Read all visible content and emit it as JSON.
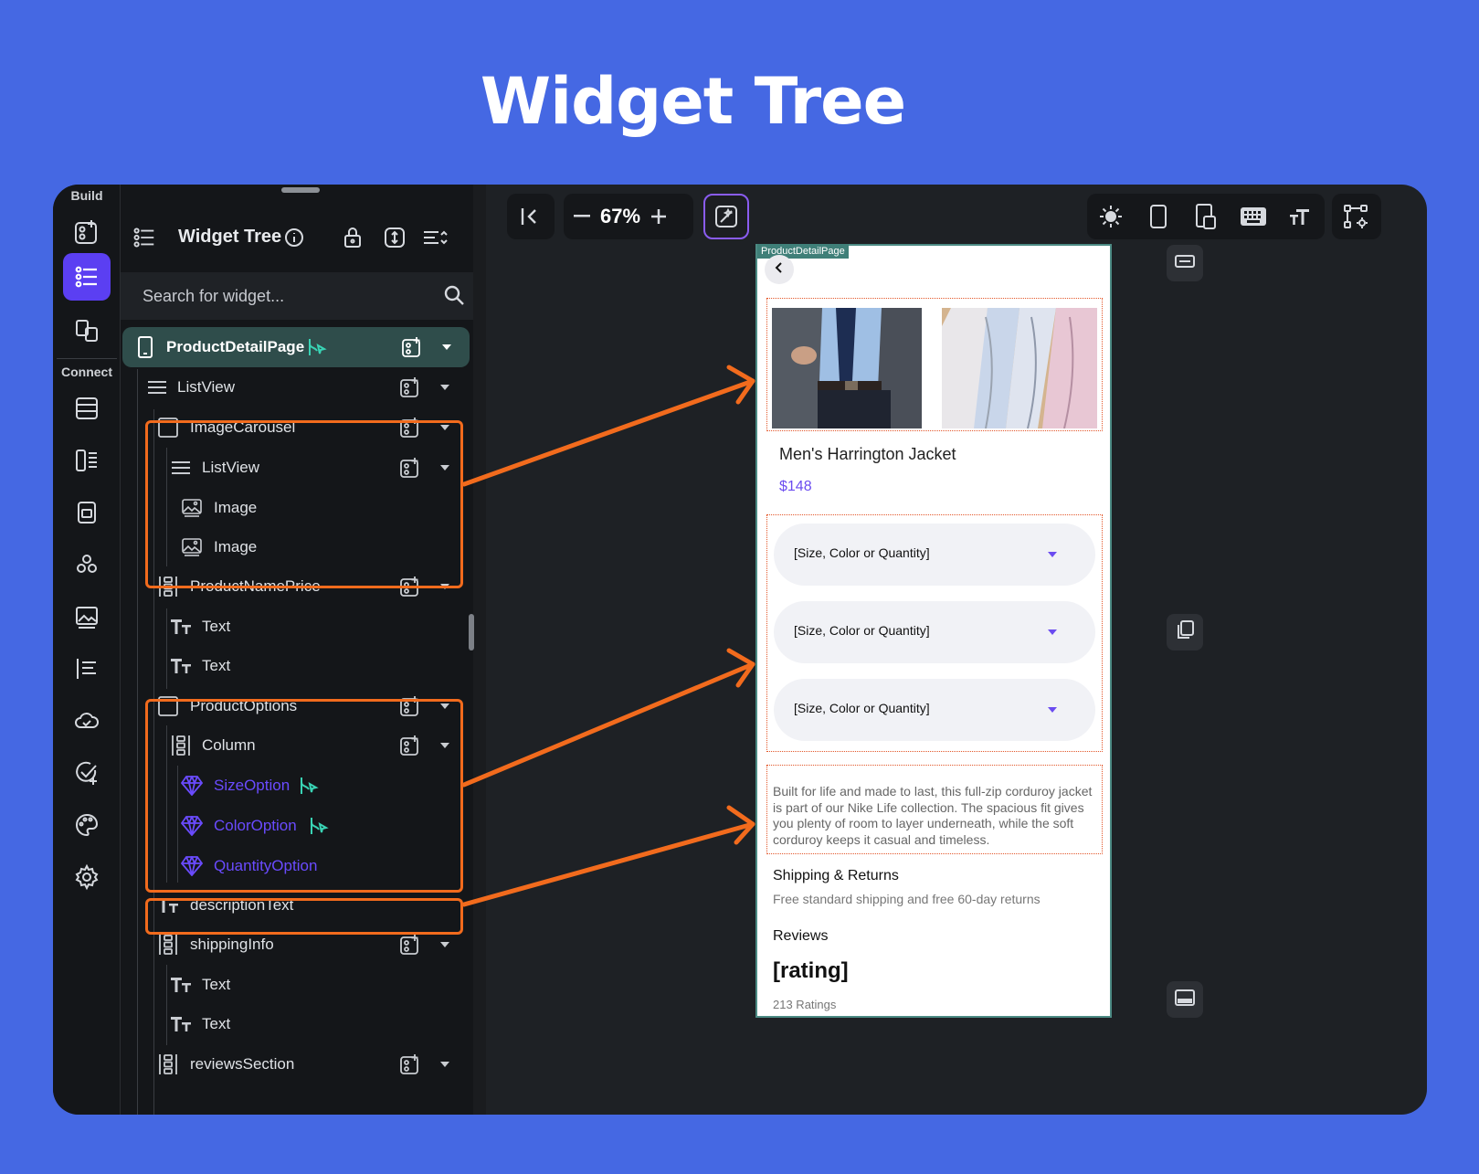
{
  "hero_title": "Widget Tree",
  "rail": {
    "build_label": "Build",
    "connect_label": "Connect"
  },
  "tree_panel": {
    "title": "Widget Tree",
    "search_placeholder": "Search for widget...",
    "rows": {
      "root": "ProductDetailPage",
      "listview_outer": "ListView",
      "image_carousel": "ImageCarousel",
      "listview_inner": "ListView",
      "image_1": "Image",
      "image_2": "Image",
      "product_name_price": "ProductNamePrice",
      "text_1": "Text",
      "text_2": "Text",
      "product_options": "ProductOptions",
      "column": "Column",
      "size_option": "SizeOption",
      "color_option": "ColorOption",
      "quantity_option": "QuantityOption",
      "description_text": "descriptionText",
      "shipping_info": "shippingInfo",
      "text_3": "Text",
      "text_4": "Text",
      "reviews_section": "reviewsSection"
    }
  },
  "toolbar": {
    "zoom": "67%"
  },
  "preview": {
    "page_tag": "ProductDetailPage",
    "product_name": "Men's Harrington Jacket",
    "price": "$148",
    "dropdowns": [
      "[Size, Color or Quantity]",
      "[Size, Color or Quantity]",
      "[Size, Color or Quantity]"
    ],
    "description": "Built for life and made to last, this full-zip corduroy jacket is part of our Nike Life collection. The spacious fit gives you plenty of room to layer underneath, while the soft corduroy keeps it casual and timeless.",
    "shipping_title": "Shipping & Returns",
    "shipping_sub": "Free standard shipping and free 60-day returns",
    "reviews_title": "Reviews",
    "rating": "[rating]",
    "rating_count": "213 Ratings"
  },
  "colors": {
    "background": "#4568e3",
    "accent_purple": "#5b3ff2",
    "highlight_orange": "#f26b1d",
    "selected_row": "#2f4d4b"
  }
}
